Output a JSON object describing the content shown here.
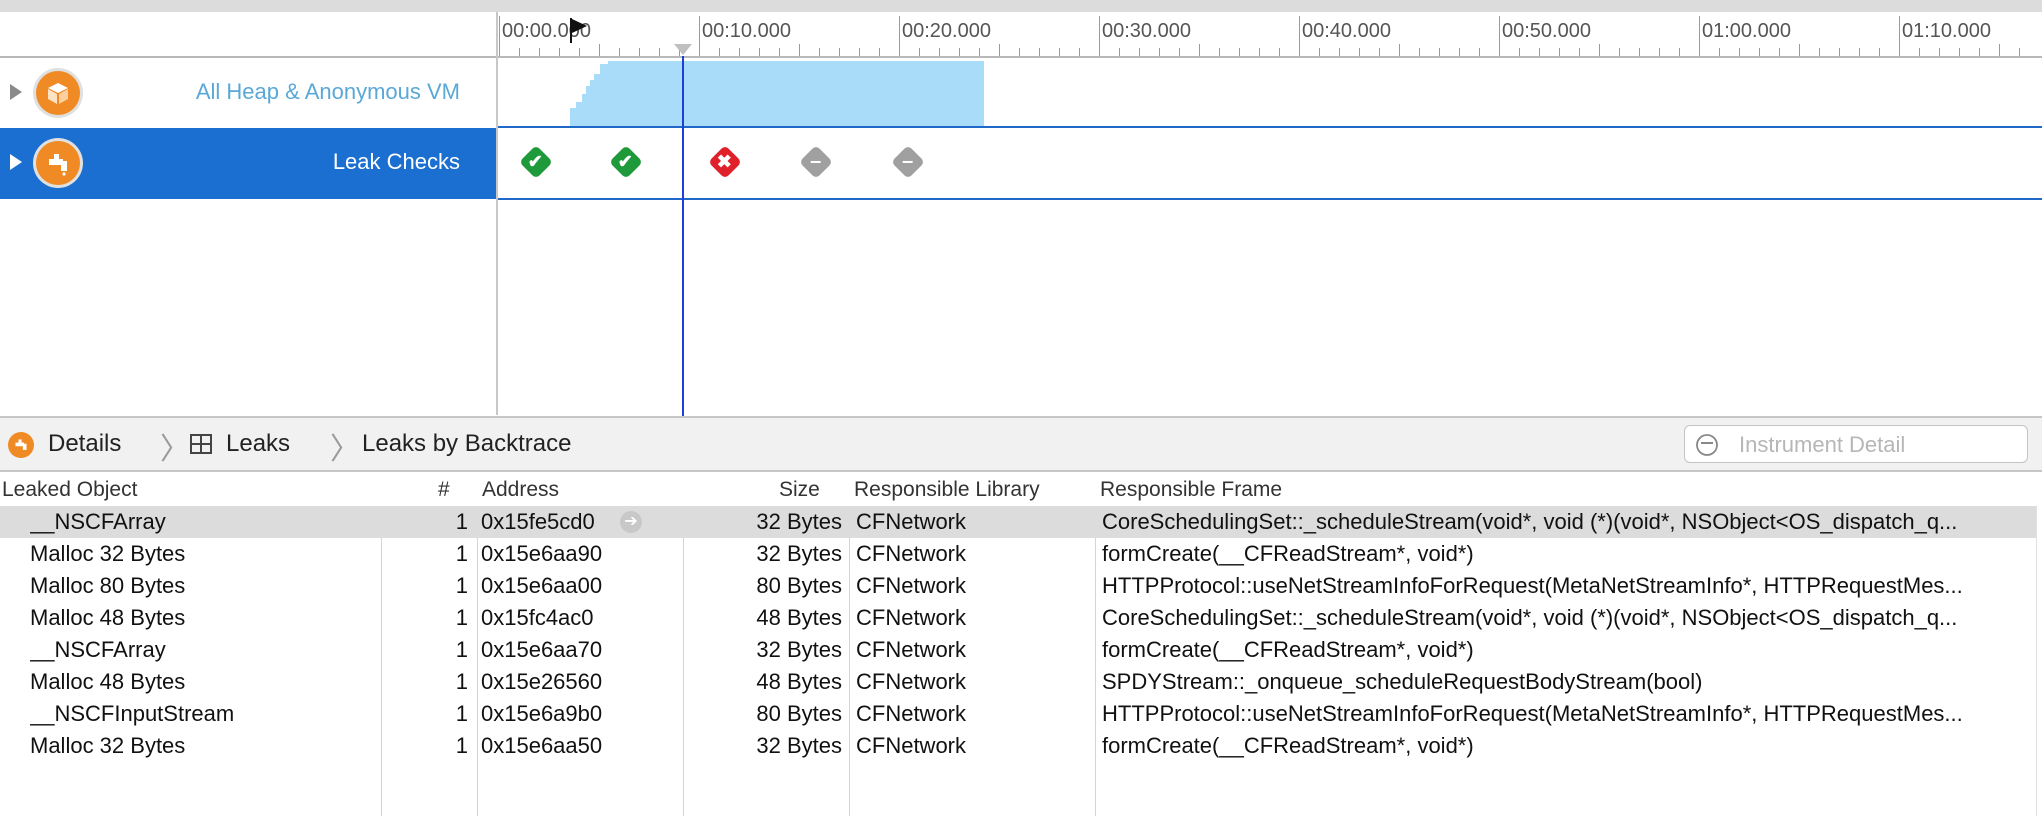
{
  "timeline": {
    "ruler_labels": [
      "00:00.000",
      "00:10.000",
      "00:20.000",
      "00:30.000",
      "00:40.000",
      "00:50.000",
      "01:00.000",
      "01:10.000"
    ]
  },
  "tracks": [
    {
      "title": "All Heap & Anonymous VM",
      "icon": "cube-icon",
      "selected": false
    },
    {
      "title": "Leak Checks",
      "icon": "leak-faucet-icon",
      "selected": true
    }
  ],
  "leak_checks": [
    "ok",
    "ok",
    "error",
    "none",
    "none"
  ],
  "details_bar": {
    "crumbs": [
      "Details",
      "Leaks",
      "Leaks by Backtrace"
    ],
    "search_placeholder": "Instrument Detail"
  },
  "table": {
    "columns": [
      "Leaked Object",
      "#",
      "Address",
      "Size",
      "Responsible Library",
      "Responsible Frame"
    ],
    "rows": [
      {
        "object": "__NSCFArray",
        "count": "1",
        "address": "0x15fe5cd0",
        "size": "32 Bytes",
        "library": "CFNetwork",
        "frame": "CoreSchedulingSet::_scheduleStream(void*, void (*)(void*, NSObject<OS_dispatch_q..."
      },
      {
        "object": "Malloc 32 Bytes",
        "count": "1",
        "address": "0x15e6aa90",
        "size": "32 Bytes",
        "library": "CFNetwork",
        "frame": "formCreate(__CFReadStream*, void*)"
      },
      {
        "object": "Malloc 80 Bytes",
        "count": "1",
        "address": "0x15e6aa00",
        "size": "80 Bytes",
        "library": "CFNetwork",
        "frame": "HTTPProtocol::useNetStreamInfoForRequest(MetaNetStreamInfo*, HTTPRequestMes..."
      },
      {
        "object": "Malloc 48 Bytes",
        "count": "1",
        "address": "0x15fc4ac0",
        "size": "48 Bytes",
        "library": "CFNetwork",
        "frame": "CoreSchedulingSet::_scheduleStream(void*, void (*)(void*, NSObject<OS_dispatch_q..."
      },
      {
        "object": "__NSCFArray",
        "count": "1",
        "address": "0x15e6aa70",
        "size": "32 Bytes",
        "library": "CFNetwork",
        "frame": "formCreate(__CFReadStream*, void*)"
      },
      {
        "object": "Malloc 48 Bytes",
        "count": "1",
        "address": "0x15e26560",
        "size": "48 Bytes",
        "library": "CFNetwork",
        "frame": "SPDYStream::_onqueue_scheduleRequestBodyStream(bool)"
      },
      {
        "object": "__NSCFInputStream",
        "count": "1",
        "address": "0x15e6a9b0",
        "size": "80 Bytes",
        "library": "CFNetwork",
        "frame": "HTTPProtocol::useNetStreamInfoForRequest(MetaNetStreamInfo*, HTTPRequestMes..."
      },
      {
        "object": "Malloc 32 Bytes",
        "count": "1",
        "address": "0x15e6aa50",
        "size": "32 Bytes",
        "library": "CFNetwork",
        "frame": "formCreate(__CFReadStream*, void*)"
      }
    ]
  },
  "colors": {
    "selection_blue": "#1a6fd0",
    "accent_orange": "#f08a24",
    "playhead": "#1f3fd6",
    "heap_fill": "#a8dcf8"
  }
}
